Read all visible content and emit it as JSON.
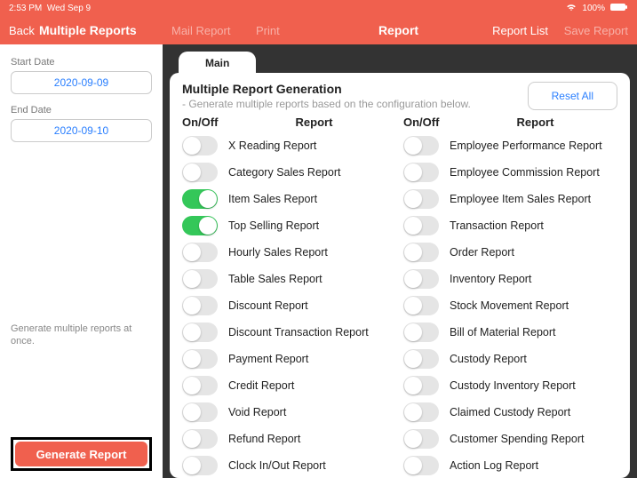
{
  "status": {
    "time": "2:53 PM",
    "date": "Wed Sep 9",
    "wifi": "􀙇",
    "battery_pct": "100%",
    "battery_icon": "􀛨"
  },
  "header": {
    "back": "Back",
    "title": "Multiple Reports",
    "mail": "Mail Report",
    "print": "Print",
    "center": "Report",
    "list": "Report List",
    "save": "Save Report"
  },
  "sidebar": {
    "start_label": "Start Date",
    "start_value": "2020-09-09",
    "end_label": "End Date",
    "end_value": "2020-09-10",
    "note": "Generate multiple reports at once.",
    "generate": "Generate Report"
  },
  "panel": {
    "tab": "Main",
    "title": "Multiple Report Generation",
    "subtitle": "- Generate multiple reports based on the configuration below.",
    "reset": "Reset All",
    "col_onoff": "On/Off",
    "col_report": "Report",
    "left": [
      {
        "label": "X Reading Report",
        "on": false
      },
      {
        "label": "Category Sales Report",
        "on": false
      },
      {
        "label": "Item Sales Report",
        "on": true
      },
      {
        "label": "Top Selling Report",
        "on": true
      },
      {
        "label": "Hourly Sales Report",
        "on": false
      },
      {
        "label": "Table Sales Report",
        "on": false
      },
      {
        "label": "Discount Report",
        "on": false
      },
      {
        "label": "Discount Transaction Report",
        "on": false
      },
      {
        "label": "Payment Report",
        "on": false
      },
      {
        "label": "Credit Report",
        "on": false
      },
      {
        "label": "Void Report",
        "on": false
      },
      {
        "label": "Refund Report",
        "on": false
      },
      {
        "label": "Clock In/Out Report",
        "on": false
      }
    ],
    "right": [
      {
        "label": "Employee Performance Report",
        "on": false
      },
      {
        "label": "Employee Commission Report",
        "on": false
      },
      {
        "label": "Employee Item Sales Report",
        "on": false
      },
      {
        "label": "Transaction Report",
        "on": false
      },
      {
        "label": "Order Report",
        "on": false
      },
      {
        "label": "Inventory Report",
        "on": false
      },
      {
        "label": "Stock Movement Report",
        "on": false
      },
      {
        "label": "Bill of Material Report",
        "on": false
      },
      {
        "label": "Custody Report",
        "on": false
      },
      {
        "label": "Custody Inventory Report",
        "on": false
      },
      {
        "label": "Claimed Custody Report",
        "on": false
      },
      {
        "label": "Customer Spending Report",
        "on": false
      },
      {
        "label": "Action Log Report",
        "on": false
      }
    ]
  }
}
